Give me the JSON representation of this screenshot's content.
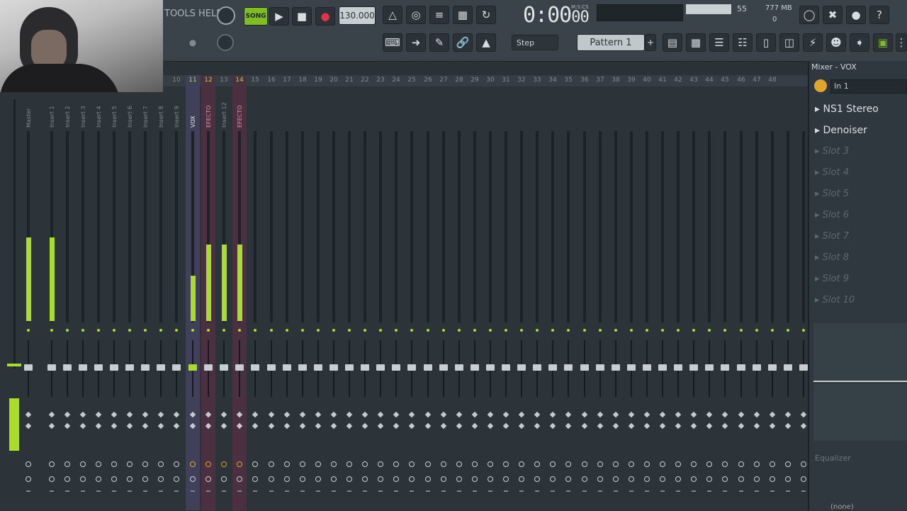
{
  "menu": {
    "tools_help": "TOOLS HELP"
  },
  "transport": {
    "mode": "SONG",
    "tempo": "130.000"
  },
  "time": {
    "main": "0:00",
    "sub": "00",
    "label": "M:S:CS"
  },
  "cpu": {
    "value": "55",
    "memory": "777 MB",
    "polyphony": "0"
  },
  "snap": {
    "value": "Step"
  },
  "pattern": {
    "value": "Pattern 1"
  },
  "mixer": {
    "strip_numbers": [
      "1",
      "10",
      "11",
      "12",
      "13",
      "14",
      "15",
      "16",
      "17",
      "18",
      "19",
      "20",
      "21",
      "22",
      "23",
      "24",
      "25",
      "26",
      "27",
      "28",
      "29",
      "30",
      "31",
      "32",
      "33",
      "34",
      "35",
      "36",
      "37",
      "38",
      "39",
      "40",
      "41",
      "42",
      "43",
      "44",
      "45",
      "46",
      "47",
      "48"
    ],
    "master_label": "Master",
    "strip_names": [
      "Insert 1",
      "Insert 2",
      "Insert 3",
      "Insert 4",
      "Insert 5",
      "Insert 6",
      "Insert 7",
      "Insert 8",
      "Insert 9",
      "VOX",
      "EFECTO",
      "Insert 12",
      "EFECTO"
    ]
  },
  "side": {
    "title": "Mixer - VOX",
    "input": "In 1",
    "slots": [
      "NS1 Stereo",
      "Denoiser",
      "Slot 3",
      "Slot 4",
      "Slot 5",
      "Slot 6",
      "Slot 7",
      "Slot 8",
      "Slot 9",
      "Slot 10"
    ],
    "eq_label": "Equalizer",
    "out_label": "(none)"
  }
}
